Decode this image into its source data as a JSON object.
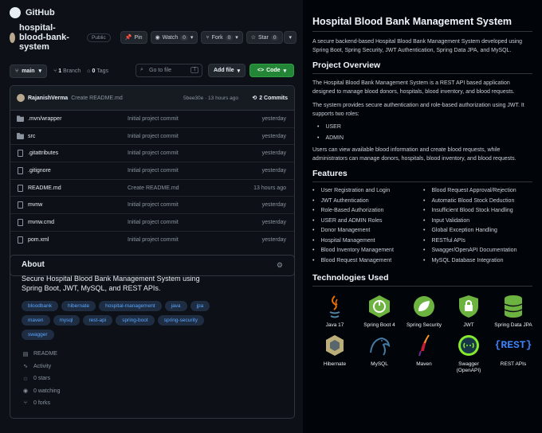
{
  "header": {
    "brand": "GitHub"
  },
  "repo": {
    "name": "hospital-blood-bank-system",
    "visibility": "Public",
    "pin_label": "Pin",
    "watch_label": "Watch",
    "watch_count": "0",
    "fork_label": "Fork",
    "fork_count": "0",
    "star_label": "Star",
    "star_count": "0"
  },
  "branchbar": {
    "branch": "main",
    "branches_count": "1",
    "branches_label": "Branch",
    "tags_count": "0",
    "tags_label": "Tags",
    "goto_placeholder": "Go to file",
    "goto_key": "T",
    "add_file_label": "Add file",
    "code_label": "Code"
  },
  "commit": {
    "author": "RajanishVerma",
    "message": "Create README.md",
    "hash_time": "5bee30e · 13 hours ago",
    "commits": "2 Commits"
  },
  "files": [
    {
      "name": ".mvn/wrapper",
      "type": "dir",
      "message": "Initial project commit",
      "date": "yesterday"
    },
    {
      "name": "src",
      "type": "dir",
      "message": "Initial project commit",
      "date": "yesterday"
    },
    {
      "name": ".gitattributes",
      "type": "file",
      "message": "Initial project commit",
      "date": "yesterday"
    },
    {
      "name": ".gitignore",
      "type": "file",
      "message": "Initial project commit",
      "date": "yesterday"
    },
    {
      "name": "README.md",
      "type": "file",
      "message": "Create README.md",
      "date": "13 hours ago"
    },
    {
      "name": "mvnw",
      "type": "file",
      "message": "Initial project commit",
      "date": "yesterday"
    },
    {
      "name": "mvnw.cmd",
      "type": "file",
      "message": "Initial project commit",
      "date": "yesterday"
    },
    {
      "name": "pom.xml",
      "type": "file",
      "message": "Initial project commit",
      "date": "yesterday"
    }
  ],
  "about": {
    "title": "About",
    "description": "Secure Hospital Blood Bank Management System using Spring Boot, JWT, MySQL, and REST APIs.",
    "topics": [
      "bloodbank",
      "hibernate",
      "hospital-management",
      "java",
      "jpa",
      "maven",
      "mysql",
      "rest-api",
      "spring-boot",
      "spring-security",
      "swagger"
    ],
    "stats": {
      "readme": "README",
      "activity": "Activity",
      "stars": "0 stars",
      "watching": "0 watching",
      "forks": "0 forks"
    }
  },
  "readme": {
    "title": "Hospital Blood Bank Management System",
    "intro": "A secure backend-based Hospital Blood Bank Management System developed using Spring Boot, Spring Security, JWT Authentication, Spring Data JPA, and MySQL.",
    "overview_heading": "Project Overview",
    "overview_p1": "The Hospital Blood Bank Management System is a REST API based application designed to manage blood donors, hospitals, blood inventory, and blood requests.",
    "overview_p2": "The system provides secure authentication and role-based authorization using JWT. It supports two roles:",
    "roles": [
      "USER",
      "ADMIN"
    ],
    "overview_p3": "Users can view available blood information and create blood requests, while administrators can manage donors, hospitals, blood inventory, and blood requests.",
    "features_heading": "Features",
    "features": [
      "User Registration and Login",
      "Blood Request Approval/Rejection",
      "JWT Authentication",
      "Automatic Blood Stock Deduction",
      "Role-Based Authorization",
      "Insufficient Blood Stock Handling",
      "USER and ADMIN Roles",
      "Input Validation",
      "Donor Management",
      "Global Exception Handling",
      "Hospital Management",
      "RESTful APIs",
      "Blood Inventory Management",
      "Swagger/OpenAPI Documentation",
      "Blood Request Management",
      "MySQL Database Integration"
    ],
    "tech_heading": "Technologies Used",
    "technologies": [
      {
        "label": "Java 17",
        "icon": "java-icon"
      },
      {
        "label": "Spring Boot 4",
        "icon": "spring-boot-icon"
      },
      {
        "label": "Spring Security",
        "icon": "spring-security-icon"
      },
      {
        "label": "JWT",
        "icon": "jwt-icon"
      },
      {
        "label": "Spring Data JPA",
        "icon": "database-icon"
      },
      {
        "label": "Hibernate",
        "icon": "hibernate-icon"
      },
      {
        "label": "MySQL",
        "icon": "mysql-icon"
      },
      {
        "label": "Maven",
        "icon": "maven-icon"
      },
      {
        "label": "Swagger (OpenAPI)",
        "icon": "swagger-icon"
      },
      {
        "label": "REST APIs",
        "icon": "rest-icon"
      }
    ],
    "rest_logo_text": "{REST}"
  },
  "colors": {
    "accent": "#238636",
    "link": "#58a6ff",
    "bg": "#0d1117",
    "spring": "#6db33f"
  }
}
